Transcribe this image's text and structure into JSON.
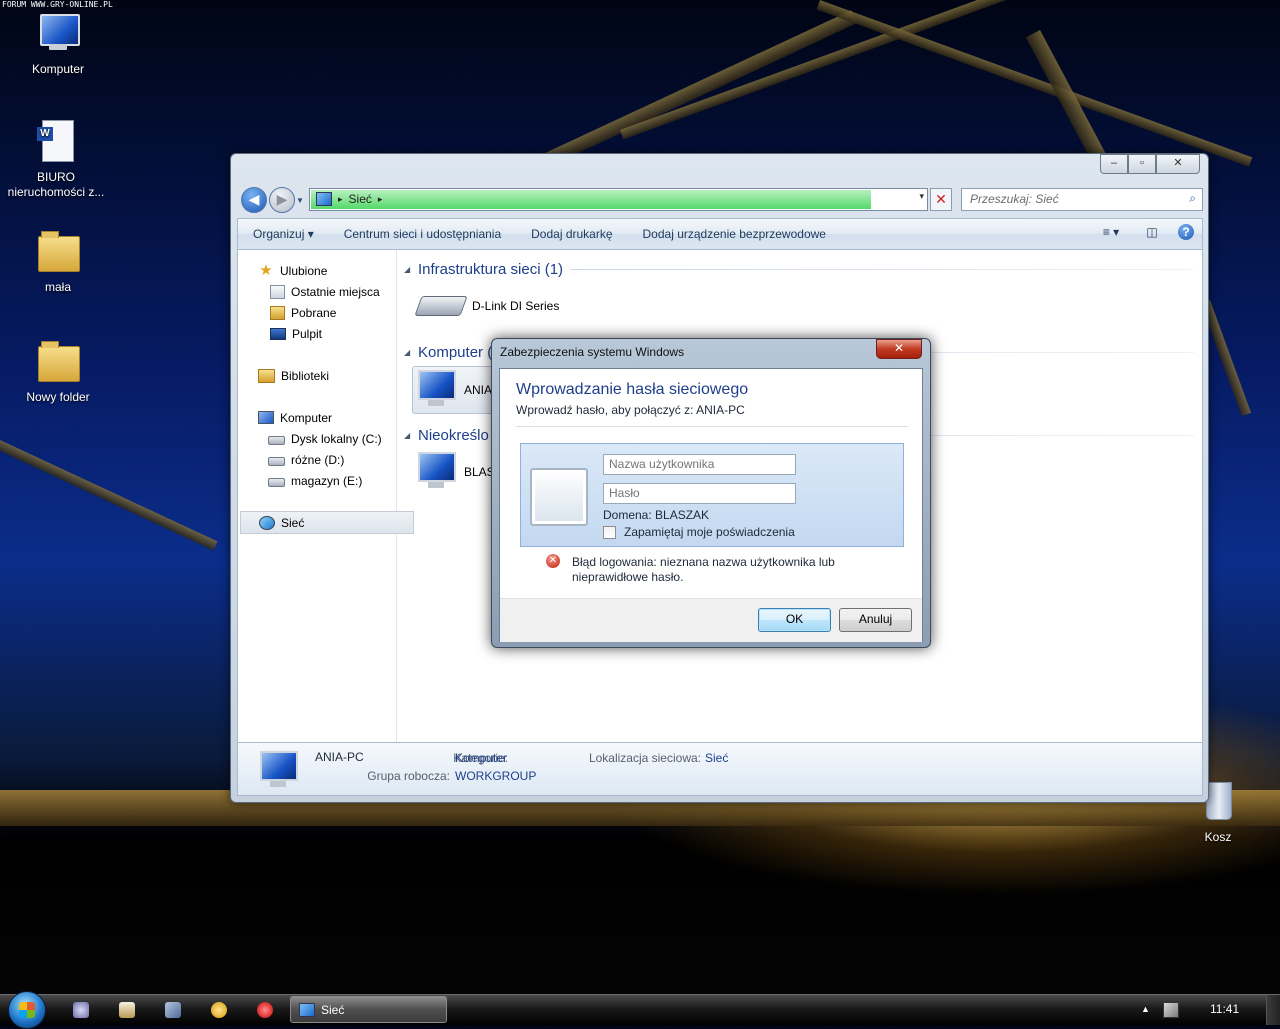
{
  "watermark": "FORUM WWW.GRY-ONLINE.PL",
  "desktop": {
    "icons": [
      {
        "label": "Komputer",
        "icon": "computer-icon"
      },
      {
        "label": "BIURO nieruchomości z...",
        "icon": "word-document-icon"
      },
      {
        "label": "mała",
        "icon": "folder-icon"
      },
      {
        "label": "Nowy folder",
        "icon": "folder-icon"
      },
      {
        "label": "Kosz",
        "icon": "recycle-bin-icon"
      }
    ]
  },
  "explorer": {
    "caption_buttons": {
      "minimize": "‒",
      "maximize": "▫",
      "close": "✕"
    },
    "address": {
      "segments": [
        "Sieć"
      ],
      "separator": "▸",
      "dropdown": "▾",
      "stop": "✕"
    },
    "search": {
      "placeholder": "Przeszukaj: Sieć",
      "icon": "magnifier-icon"
    },
    "toolbar": {
      "organize": "Organizuj ▾",
      "network_center": "Centrum sieci i udostępniania",
      "add_printer": "Dodaj drukarkę",
      "add_wireless": "Dodaj urządzenie bezprzewodowe",
      "views": "≡ ▾",
      "preview": "◫",
      "help": "?"
    },
    "nav": {
      "favorites": "Ulubione",
      "recent": "Ostatnie miejsca",
      "downloads": "Pobrane",
      "desktop": "Pulpit",
      "libraries": "Biblioteki",
      "computer": "Komputer",
      "drive_c": "Dysk lokalny (C:)",
      "drive_d": "różne (D:)",
      "drive_e": "magazyn (E:)",
      "network": "Sieć"
    },
    "groups": [
      {
        "title": "Infrastruktura sieci (1)",
        "items": [
          "D-Link DI Series"
        ]
      },
      {
        "title": "Komputer (",
        "items": [
          "ANIA"
        ]
      },
      {
        "title": "Nieokreślo",
        "items": [
          "BLAS"
        ]
      }
    ],
    "details": {
      "name": "ANIA-PC",
      "category_label": "Kategorie:",
      "category_value": "Komputer",
      "workgroup_label": "Grupa robocza:",
      "workgroup_value": "WORKGROUP",
      "location_label": "Lokalizacja sieciowa:",
      "location_value": "Sieć"
    }
  },
  "dialog": {
    "title": "Zabezpieczenia systemu Windows",
    "close": "✕",
    "heading": "Wprowadzanie hasła sieciowego",
    "subheading": "Wprowadź hasło, aby połączyć z: ANIA-PC",
    "username_placeholder": "Nazwa użytkownika",
    "password_placeholder": "Hasło",
    "domain": "Domena: BLASZAK",
    "remember": "Zapamiętaj moje poświadczenia",
    "error": "Błąd logowania: nieznana nazwa użytkownika lub nieprawidłowe hasło.",
    "ok": "OK",
    "cancel": "Anuluj"
  },
  "taskbar": {
    "task_label": "Sieć",
    "tray_arrow": "▲",
    "clock": "11:41"
  }
}
